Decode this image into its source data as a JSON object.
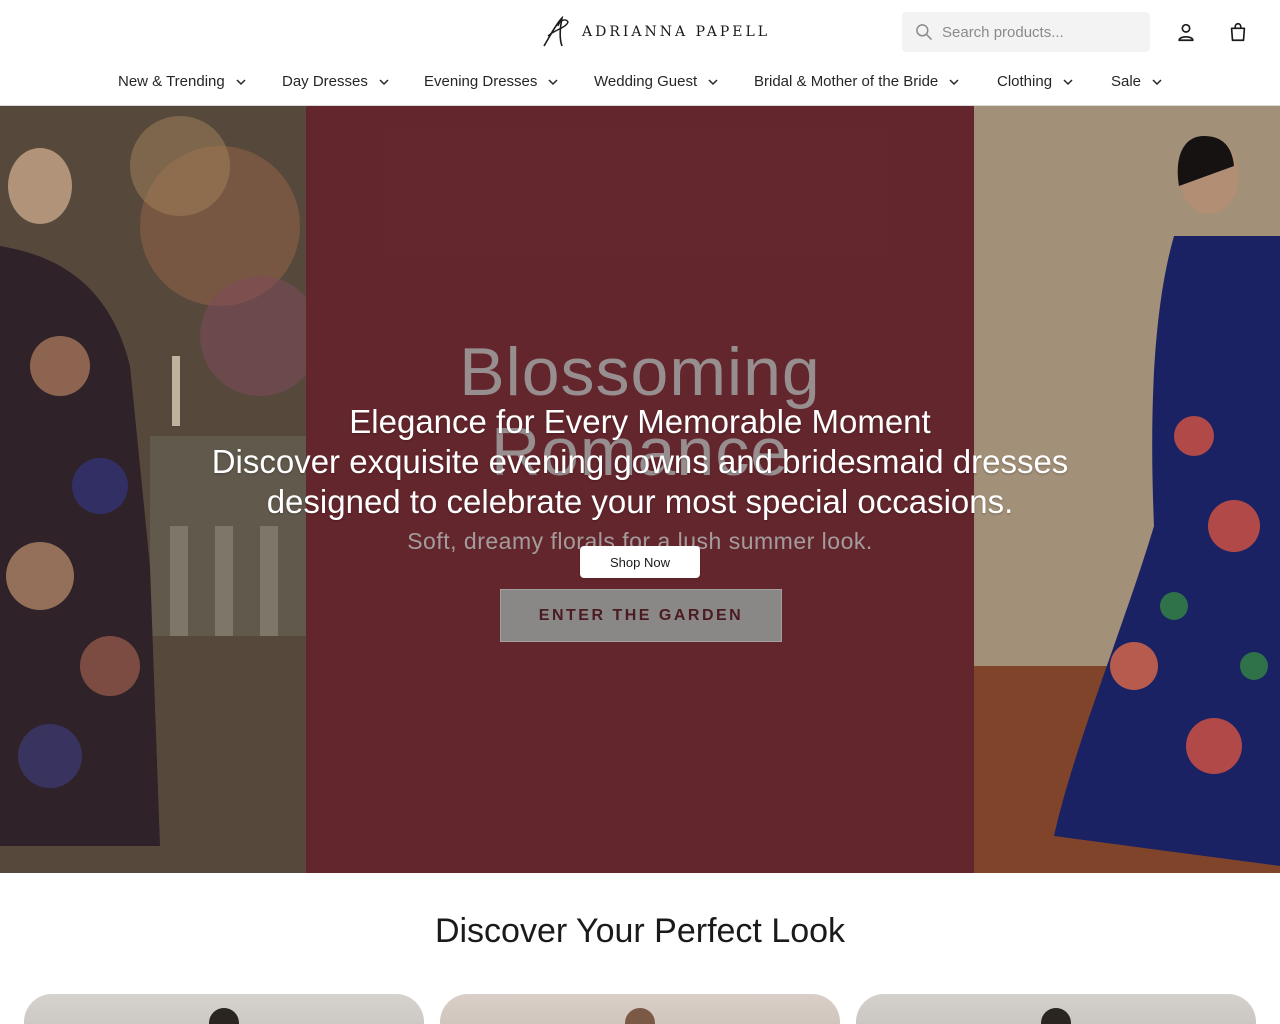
{
  "brand": {
    "name": "ADRIANNA PAPELL"
  },
  "header": {
    "search_placeholder": "Search products...",
    "icons": {
      "search": "search-icon",
      "account": "user-icon",
      "cart": "shopping-bag-icon"
    }
  },
  "nav": {
    "items": [
      {
        "label": "New & Trending"
      },
      {
        "label": "Day Dresses"
      },
      {
        "label": "Evening Dresses"
      },
      {
        "label": "Wedding Guest"
      },
      {
        "label": "Bridal & Mother of the Bride"
      },
      {
        "label": "Clothing"
      },
      {
        "label": "Sale"
      }
    ]
  },
  "hero": {
    "promo": {
      "line1": "Blossoming",
      "line2": "Romance",
      "subtitle": "Soft, dreamy florals for a lush summer look.",
      "cta": "ENTER THE GARDEN"
    },
    "title": "Elegance for Every Memorable Moment",
    "description": "Discover exquisite evening gowns and bridesmaid dresses designed to celebrate your most special occasions.",
    "button": "Shop Now"
  },
  "section": {
    "title": "Discover Your Perfect Look"
  },
  "colors": {
    "promo_background": "#7a2f38",
    "cta_text": "#5b2229",
    "header_background": "#ffffff",
    "search_background": "#f3f3f3"
  }
}
